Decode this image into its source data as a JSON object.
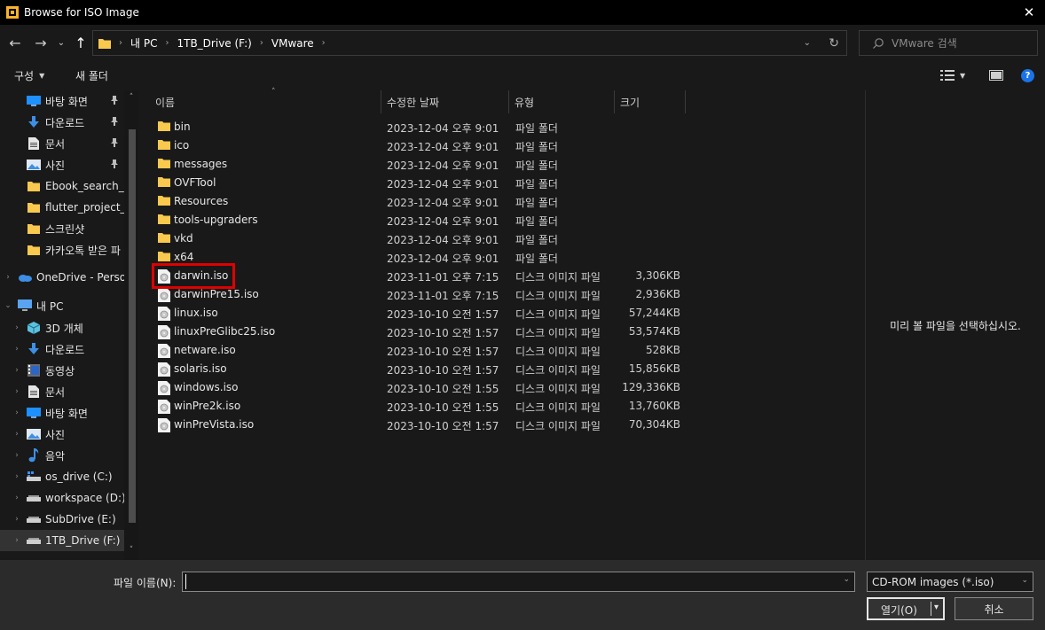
{
  "window": {
    "title": "Browse for ISO Image",
    "close_glyph": "✕",
    "icon": "vmware-app-icon"
  },
  "nav_buttons": {
    "back": "←",
    "forward": "→",
    "recent": "⌄",
    "up": "↑"
  },
  "address": {
    "crumbs": [
      "내 PC",
      "1TB_Drive (F:)",
      "VMware"
    ],
    "separator": "›",
    "dropdown_glyph": "⌄",
    "refresh_glyph": "↻"
  },
  "search": {
    "placeholder": "VMware 검색",
    "icon": "search-icon"
  },
  "commandbar": {
    "organize": "구성",
    "new_folder": "새 폴더",
    "view_icon": "view-options-icon",
    "preview_icon": "preview-pane-icon",
    "help": "?"
  },
  "nav_pane": {
    "items": [
      {
        "label": "바탕 화면",
        "icon": "desktop-icon",
        "pinned": true
      },
      {
        "label": "다운로드",
        "icon": "download-icon",
        "pinned": true
      },
      {
        "label": "문서",
        "icon": "documents-icon",
        "pinned": true
      },
      {
        "label": "사진",
        "icon": "pictures-icon",
        "pinned": true
      },
      {
        "label": "Ebook_search_ar",
        "icon": "folder-icon"
      },
      {
        "label": "flutter_project_b",
        "icon": "folder-icon"
      },
      {
        "label": "스크린샷",
        "icon": "folder-icon"
      },
      {
        "label": "카카오톡 받은 파",
        "icon": "folder-icon"
      },
      {
        "label": "OneDrive - Persor",
        "icon": "onedrive-icon"
      },
      {
        "label": "내 PC",
        "icon": "this-pc-icon"
      },
      {
        "label": "3D 개체",
        "icon": "3d-objects-icon"
      },
      {
        "label": "다운로드",
        "icon": "download-icon"
      },
      {
        "label": "동영상",
        "icon": "videos-icon"
      },
      {
        "label": "문서",
        "icon": "documents-icon"
      },
      {
        "label": "바탕 화면",
        "icon": "desktop-icon"
      },
      {
        "label": "사진",
        "icon": "pictures-icon"
      },
      {
        "label": "음악",
        "icon": "music-icon"
      },
      {
        "label": "os_drive (C:)",
        "icon": "windows-drive-icon"
      },
      {
        "label": "workspace (D:)",
        "icon": "drive-icon"
      },
      {
        "label": "SubDrive (E:)",
        "icon": "drive-icon"
      },
      {
        "label": "1TB_Drive (F:)",
        "icon": "drive-icon",
        "selected": true
      }
    ],
    "pin_glyph": "📌",
    "expand_glyph": "›",
    "collapse_glyph": "⌄",
    "scroll_up": "˄",
    "scroll_down": "˅"
  },
  "columns": {
    "name": "이름",
    "modified": "수정한 날짜",
    "type": "유형",
    "size": "크기",
    "sort_glyph": "˄"
  },
  "files": [
    {
      "name": "bin",
      "modified": "2023-12-04 오후 9:01",
      "type": "파일 폴더",
      "size": "",
      "kind": "folder"
    },
    {
      "name": "ico",
      "modified": "2023-12-04 오후 9:01",
      "type": "파일 폴더",
      "size": "",
      "kind": "folder"
    },
    {
      "name": "messages",
      "modified": "2023-12-04 오후 9:01",
      "type": "파일 폴더",
      "size": "",
      "kind": "folder"
    },
    {
      "name": "OVFTool",
      "modified": "2023-12-04 오후 9:01",
      "type": "파일 폴더",
      "size": "",
      "kind": "folder"
    },
    {
      "name": "Resources",
      "modified": "2023-12-04 오후 9:01",
      "type": "파일 폴더",
      "size": "",
      "kind": "folder"
    },
    {
      "name": "tools-upgraders",
      "modified": "2023-12-04 오후 9:01",
      "type": "파일 폴더",
      "size": "",
      "kind": "folder"
    },
    {
      "name": "vkd",
      "modified": "2023-12-04 오후 9:01",
      "type": "파일 폴더",
      "size": "",
      "kind": "folder"
    },
    {
      "name": "x64",
      "modified": "2023-12-04 오후 9:01",
      "type": "파일 폴더",
      "size": "",
      "kind": "folder"
    },
    {
      "name": "darwin.iso",
      "modified": "2023-11-01 오후 7:15",
      "type": "디스크 이미지 파일",
      "size": "3,306KB",
      "kind": "iso"
    },
    {
      "name": "darwinPre15.iso",
      "modified": "2023-11-01 오후 7:15",
      "type": "디스크 이미지 파일",
      "size": "2,936KB",
      "kind": "iso"
    },
    {
      "name": "linux.iso",
      "modified": "2023-10-10 오전 1:57",
      "type": "디스크 이미지 파일",
      "size": "57,244KB",
      "kind": "iso"
    },
    {
      "name": "linuxPreGlibc25.iso",
      "modified": "2023-10-10 오전 1:57",
      "type": "디스크 이미지 파일",
      "size": "53,574KB",
      "kind": "iso"
    },
    {
      "name": "netware.iso",
      "modified": "2023-10-10 오전 1:57",
      "type": "디스크 이미지 파일",
      "size": "528KB",
      "kind": "iso"
    },
    {
      "name": "solaris.iso",
      "modified": "2023-10-10 오전 1:57",
      "type": "디스크 이미지 파일",
      "size": "15,856KB",
      "kind": "iso"
    },
    {
      "name": "windows.iso",
      "modified": "2023-10-10 오전 1:55",
      "type": "디스크 이미지 파일",
      "size": "129,336KB",
      "kind": "iso"
    },
    {
      "name": "winPre2k.iso",
      "modified": "2023-10-10 오전 1:55",
      "type": "디스크 이미지 파일",
      "size": "13,760KB",
      "kind": "iso"
    },
    {
      "name": "winPreVista.iso",
      "modified": "2023-10-10 오전 1:57",
      "type": "디스크 이미지 파일",
      "size": "70,304KB",
      "kind": "iso"
    }
  ],
  "preview": {
    "message": "미리 볼 파일을 선택하십시오."
  },
  "footer": {
    "filename_label": "파일 이름(N):",
    "filename_value": "",
    "filter": "CD-ROM images (*.iso)",
    "open": "열기(O)",
    "cancel": "취소",
    "dropdown_glyph": "⌄",
    "open_caret": "▾"
  },
  "colors": {
    "background": "#191919",
    "titlebar": "#000000",
    "folder": "#f8c94e",
    "highlight": "#e00000",
    "accent_help": "#1a73e8"
  }
}
